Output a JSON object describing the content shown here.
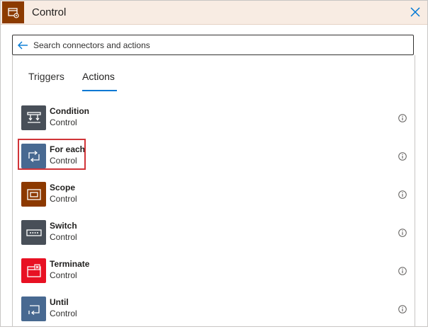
{
  "header": {
    "title": "Control",
    "icon": "control-settings-icon",
    "close_icon": "close-icon",
    "brand_color": "#8c3b00"
  },
  "search": {
    "placeholder": "Search connectors and actions",
    "value": ""
  },
  "tabs": [
    {
      "label": "Triggers",
      "selected": false
    },
    {
      "label": "Actions",
      "selected": true
    }
  ],
  "actions": [
    {
      "name": "Condition",
      "connector": "Control",
      "icon": "condition-icon",
      "color": "#484f58"
    },
    {
      "name": "For each",
      "connector": "Control",
      "icon": "for-each-icon",
      "color": "#486991",
      "highlighted": true
    },
    {
      "name": "Scope",
      "connector": "Control",
      "icon": "scope-icon",
      "color": "#8c3900"
    },
    {
      "name": "Switch",
      "connector": "Control",
      "icon": "switch-icon",
      "color": "#484f58"
    },
    {
      "name": "Terminate",
      "connector": "Control",
      "icon": "terminate-icon",
      "color": "#e81123"
    },
    {
      "name": "Until",
      "connector": "Control",
      "icon": "until-icon",
      "color": "#486991"
    }
  ]
}
